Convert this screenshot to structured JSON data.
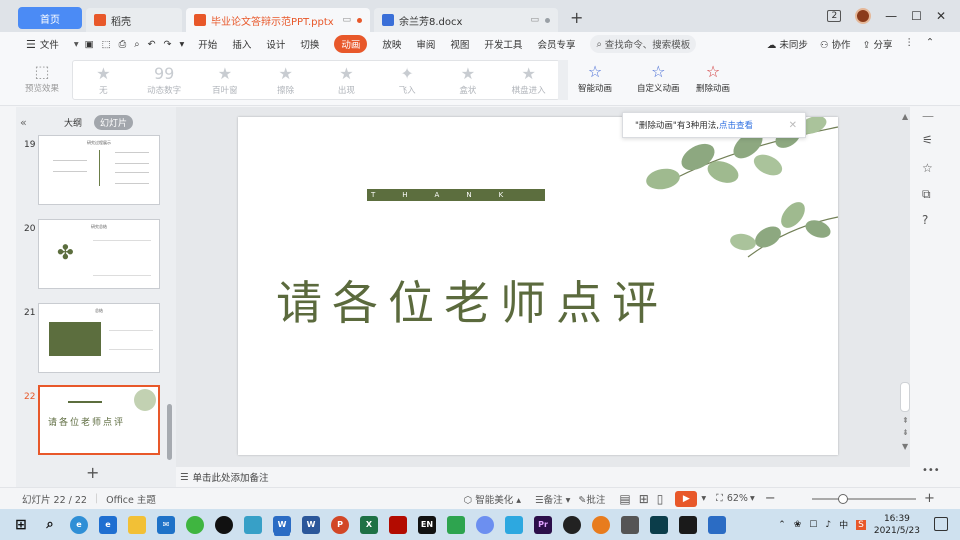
{
  "titlebar": {
    "home_tab": "首页",
    "tabs": [
      {
        "label": "稻壳",
        "icon": "daoke-icon"
      },
      {
        "label": "毕业论文答辩示范PPT.pptx",
        "icon": "ppt-file-icon"
      },
      {
        "label": "余兰芳8.docx",
        "icon": "word-file-icon"
      }
    ],
    "window_badge": "2"
  },
  "menu": {
    "file": "文件",
    "items": [
      "开始",
      "插入",
      "设计",
      "切换",
      "动画",
      "放映",
      "审阅",
      "视图",
      "开发工具",
      "会员专享"
    ],
    "active": "动画",
    "search_placeholder": "查找命令、搜索模板",
    "right_items": [
      "未同步",
      "协作",
      "分享"
    ]
  },
  "ribbon": {
    "preview": "预览效果",
    "animations": [
      "无",
      "动态数字",
      "百叶窗",
      "擦除",
      "出现",
      "飞入",
      "盒状",
      "棋盘进入"
    ],
    "smart_animation": "智能动画",
    "custom_animation": "自定义动画",
    "delete_animation": "删除动画"
  },
  "leftpanel": {
    "tabs": [
      "大纲",
      "幻灯片"
    ],
    "active_tab": "幻灯片",
    "slides": [
      {
        "num": "19",
        "title": "研究过程展示"
      },
      {
        "num": "20",
        "title": "研究总结"
      },
      {
        "num": "21",
        "title": "总结"
      },
      {
        "num": "22",
        "title": "请各位老师点评"
      }
    ]
  },
  "slide": {
    "banner": "THANK YOU",
    "title": "请各位老师点评"
  },
  "tooltip": {
    "text": "\"删除动画\"有3种用法,",
    "link": "点击查看"
  },
  "notes": {
    "placeholder": "单击此处添加备注"
  },
  "statusbar": {
    "slide_count": "幻灯片 22 / 22",
    "theme": "Office 主题",
    "smart_beautify": "智能美化",
    "notes": "备注",
    "comments": "批注",
    "zoom": "62%",
    "zoom_fraction": 0.3
  },
  "taskbar": {
    "time": "16:39",
    "date": "2021/5/23",
    "ime": "中",
    "lang": "EN"
  },
  "colors": {
    "accent": "#e8582a",
    "olive": "#5b6a3d",
    "home_tab": "#4b8bf5"
  }
}
